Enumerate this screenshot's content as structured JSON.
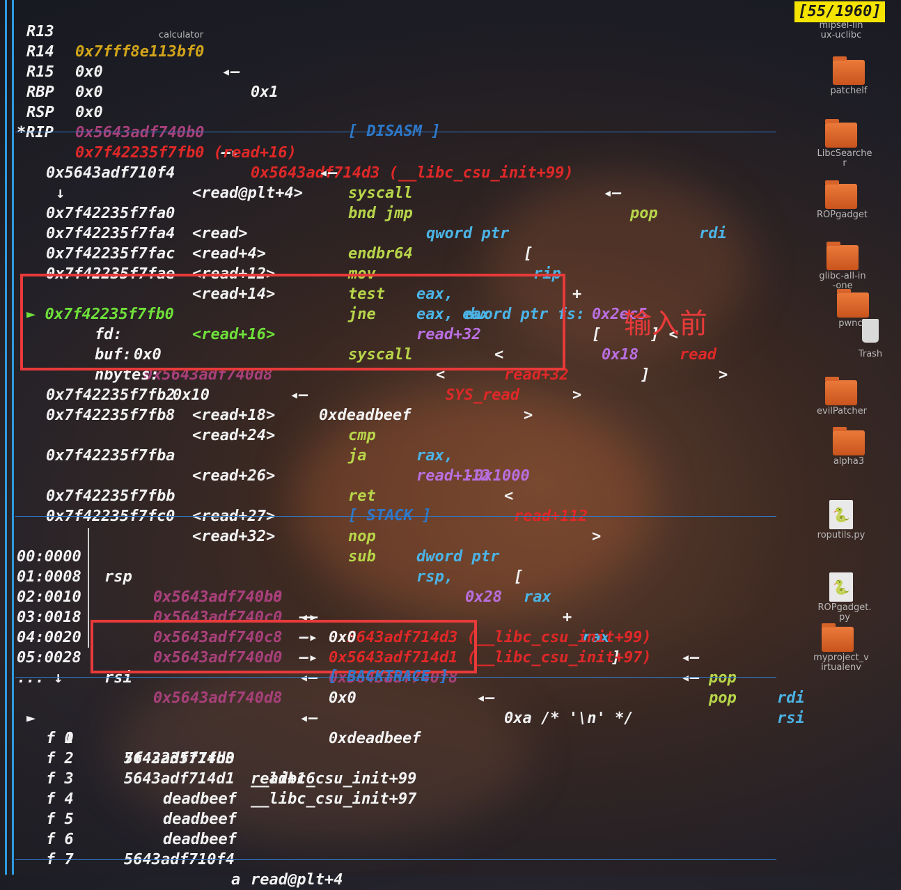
{
  "counter": "[55/1960]",
  "note": "输入前",
  "registers": [
    {
      "name": "R13",
      "value": "0x7fff8e113bf0",
      "arrow": "◂—",
      "deref": "0x1"
    },
    {
      "name": "R14",
      "value": "0x0"
    },
    {
      "name": "R15",
      "value": "0x0"
    },
    {
      "name": "RBP",
      "value": "0x0"
    },
    {
      "name": "RSP",
      "value": "0x5643adf740b0",
      "arrow": "—▸",
      "target": "0x5643adf714d3 (__libc_csu_init+99)",
      "arrow2": "◂—",
      "ins": "pop",
      "op": "rdi"
    },
    {
      "name": "*RIP",
      "value": "0x7f42235f7fb0 (read+16)",
      "arrow": "◂—",
      "ins": "syscall"
    }
  ],
  "sections": {
    "disasm": "[ DISASM ]",
    "stack": "[ STACK ]",
    "backtrace": "[ BACKTRACE ]"
  },
  "disasm": [
    {
      "addr": "0x5643adf710f4",
      "sym": "<read@plt+4>",
      "ins": "bnd jmp",
      "ops": "qword ptr [rip + 0x2ec5] <read>"
    },
    {
      "addr": "↓"
    },
    {
      "addr": "0x7f42235f7fa0",
      "sym": "<read>",
      "ins": "endbr64",
      "ops": ""
    },
    {
      "addr": "0x7f42235f7fa4",
      "sym": "<read+4>",
      "ins": "mov",
      "ops": "eax, dword ptr fs:[0x18]"
    },
    {
      "addr": "0x7f42235f7fac",
      "sym": "<read+12>",
      "ins": "test",
      "ops": "eax, eax"
    },
    {
      "addr": "0x7f42235f7fae",
      "sym": "<read+14>",
      "ins": "jne",
      "ops": "read+32 <read+32>"
    },
    {
      "addr": "► 0x7f42235f7fb0",
      "sym": "<read+16>",
      "ins": "syscall",
      "ops": "<SYS_read>"
    },
    {
      "addr": "fd:",
      "sym": "0x0"
    },
    {
      "addr": "buf:",
      "sym": "0x5643adf740d8 ◂— 0xdeadbeef"
    },
    {
      "addr": "nbytes:",
      "sym": "0x10"
    },
    {
      "addr": "0x7f42235f7fb2",
      "sym": "<read+18>",
      "ins": "cmp",
      "ops": "rax, -0x1000"
    },
    {
      "addr": "0x7f42235f7fb8",
      "sym": "<read+24>",
      "ins": "ja",
      "ops": "read+112 <read+112>"
    },
    {
      "addr": "0x7f42235f7fba",
      "sym": "<read+26>",
      "ins": "ret",
      "ops": ""
    },
    {
      "addr": "0x7f42235f7fbb",
      "sym": "<read+27>",
      "ins": "nop",
      "ops": "dword ptr [rax + rax]"
    },
    {
      "addr": "0x7f42235f7fc0",
      "sym": "<read+32>",
      "ins": "sub",
      "ops": "rsp, 0x28"
    }
  ],
  "stack": [
    {
      "idx": "00:0000",
      "reg": "rsp",
      "addr": "0x5643adf740b0",
      "arrow": "—▸",
      "val": "0x5643adf714d3 (__libc_csu_init+99)",
      "arrow2": "◂—",
      "ins": "pop",
      "op": "rdi"
    },
    {
      "idx": "01:0008",
      "reg": "",
      "addr": "0x5643adf740b8",
      "arrow": "◂—",
      "val": "0x0"
    },
    {
      "idx": "02:0010",
      "reg": "",
      "addr": "0x5643adf740c0",
      "arrow": "—▸",
      "val": "0x5643adf714d1 (__libc_csu_init+97)",
      "arrow2": "◂—",
      "ins": "pop",
      "op": "rsi"
    },
    {
      "idx": "03:0018",
      "reg": "",
      "addr": "0x5643adf740c8",
      "arrow": "—▸",
      "val": "0x5643adf740f8",
      "arrow2": "◂—",
      "ins": "0xa /* '\\n' */"
    },
    {
      "idx": "04:0020",
      "reg": "",
      "addr": "0x5643adf740d0",
      "arrow": "◂—",
      "val": "0x0"
    },
    {
      "idx": "05:0028",
      "reg": "rsi",
      "addr": "0x5643adf740d8",
      "arrow": "◂—",
      "val": "0xdeadbeef"
    },
    {
      "idx": "... ↓"
    }
  ],
  "backtrace": [
    {
      "marker": "►",
      "frame": "f 0",
      "addr": "7f42235f7fb0",
      "sym": "read+16"
    },
    {
      "marker": "",
      "frame": "f 1",
      "addr": "5643adf714d3",
      "sym": "__libc_csu_init+99"
    },
    {
      "marker": "",
      "frame": "f 2",
      "addr": "5643adf714d1",
      "sym": "__libc_csu_init+97"
    },
    {
      "marker": "",
      "frame": "f 3",
      "addr": "deadbeef",
      "sym": ""
    },
    {
      "marker": "",
      "frame": "f 4",
      "addr": "deadbeef",
      "sym": ""
    },
    {
      "marker": "",
      "frame": "f 5",
      "addr": "deadbeef",
      "sym": ""
    },
    {
      "marker": "",
      "frame": "f 6",
      "addr": "5643adf710f4",
      "sym": "read@plt+4"
    },
    {
      "marker": "",
      "frame": "f 7",
      "addr": "a",
      "sym": ""
    }
  ],
  "desktop": [
    {
      "label": "calculator",
      "icon": "calculator-icon"
    },
    {
      "label": "mipsel-linux-uclibc",
      "icon": "folder-icon"
    },
    {
      "label": "patchelf",
      "icon": "folder-icon"
    },
    {
      "label": "LibcSearcher",
      "icon": "folder-icon"
    },
    {
      "label": "ROPgadget",
      "icon": "folder-icon"
    },
    {
      "label": "glibc-all-in-one",
      "icon": "folder-icon"
    },
    {
      "label": "pwncli",
      "icon": "folder-icon"
    },
    {
      "label": "Trash",
      "icon": "trash-icon"
    },
    {
      "label": "evilPatcher",
      "icon": "folder-icon"
    },
    {
      "label": "alpha3",
      "icon": "folder-icon"
    },
    {
      "label": "roputils.py",
      "icon": "python-file-icon"
    },
    {
      "label": "ROPgadget.py",
      "icon": "python-file-icon"
    },
    {
      "label": "myproject_virtualenv",
      "icon": "folder-icon"
    }
  ],
  "colors": {
    "accent": "#2e9be0",
    "highlight_box": "#e83a3a",
    "counter_bg": "#f5e400"
  }
}
